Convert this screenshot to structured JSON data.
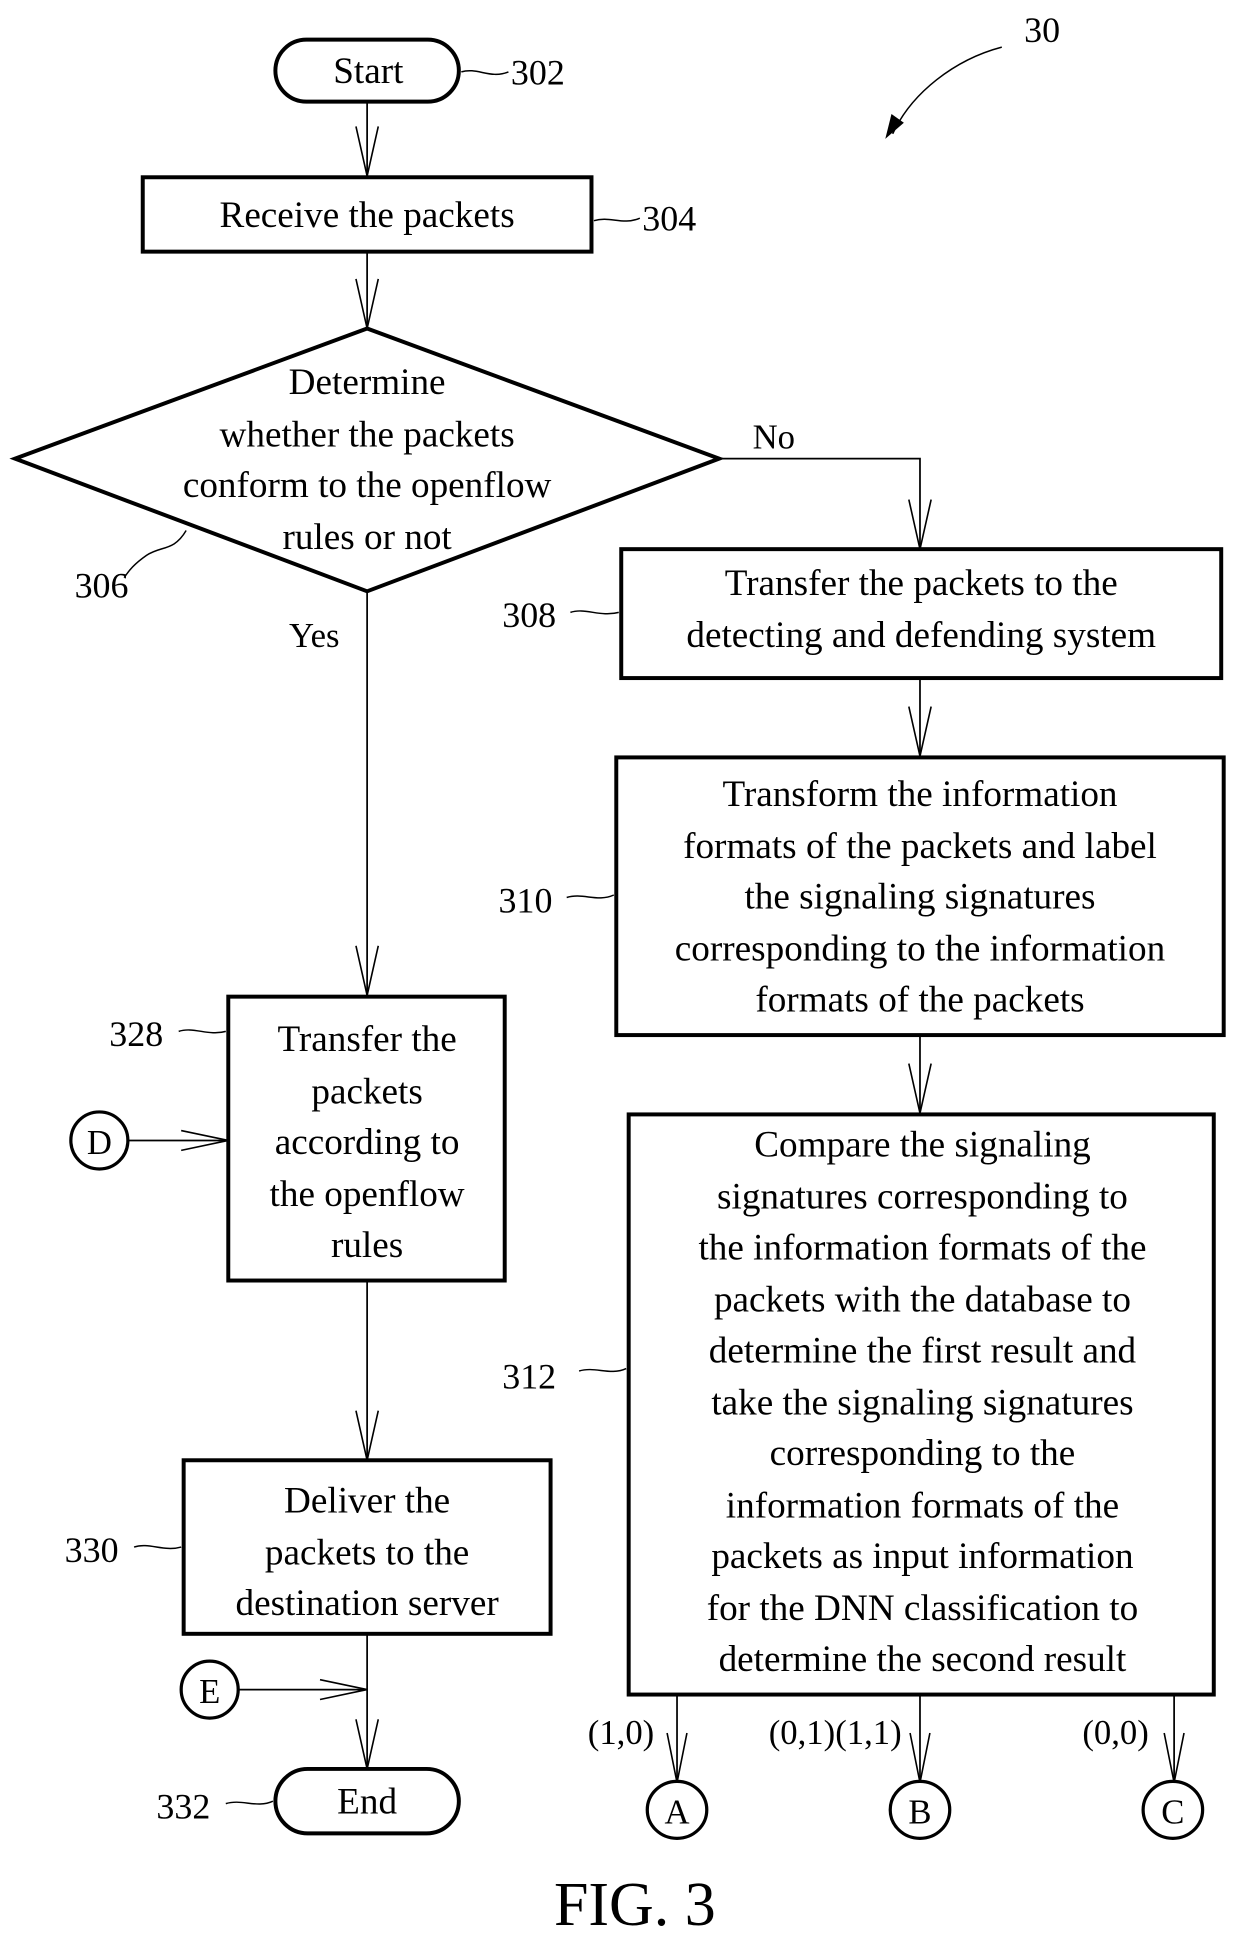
{
  "figure": {
    "title": "FIG. 3",
    "reference": "30"
  },
  "nodes": {
    "start": {
      "ref": "302",
      "label": "Start"
    },
    "receive": {
      "ref": "304",
      "label": "Receive the packets"
    },
    "decision": {
      "ref": "306",
      "lines": [
        "Determine",
        "whether the packets",
        "conform to the openflow",
        "rules or not"
      ],
      "yes_label": "Yes",
      "no_label": "No"
    },
    "transfer_detect": {
      "ref": "308",
      "lines": [
        "Transfer the packets to the",
        "detecting and defending system"
      ]
    },
    "transform": {
      "ref": "310",
      "lines": [
        "Transform the information",
        "formats of the packets and label",
        "the signaling signatures",
        "corresponding to the information",
        "formats of the packets"
      ]
    },
    "compare": {
      "ref": "312",
      "lines": [
        "Compare the signaling",
        "signatures corresponding to",
        "the information formats of the",
        "packets with the database to",
        "determine the first result and",
        "take the signaling signatures",
        "corresponding to the",
        "information formats of the",
        "packets as input information",
        "for the DNN classification to",
        "determine the second result"
      ]
    },
    "transfer_openflow": {
      "ref": "328",
      "lines": [
        "Transfer the",
        "packets",
        "according to",
        "the openflow",
        "rules"
      ]
    },
    "deliver": {
      "ref": "330",
      "lines": [
        "Deliver the",
        "packets to the",
        "destination server"
      ]
    },
    "end": {
      "ref": "332",
      "label": "End"
    }
  },
  "connectors": {
    "A": {
      "label": "A",
      "condition": "(1,0)"
    },
    "B": {
      "label": "B",
      "condition": "(0,1)(1,1)"
    },
    "C": {
      "label": "C",
      "condition": "(0,0)"
    },
    "D": {
      "label": "D"
    },
    "E": {
      "label": "E"
    }
  }
}
